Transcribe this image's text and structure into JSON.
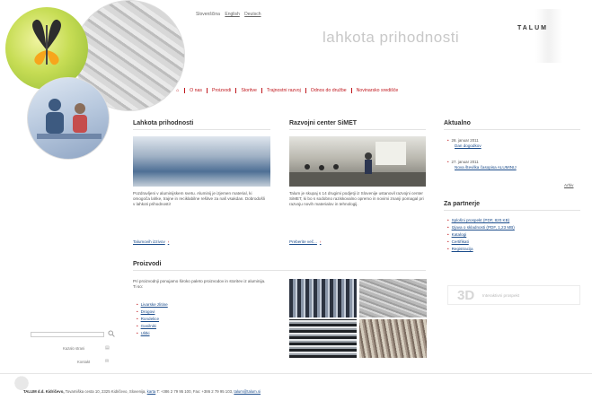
{
  "header": {
    "top_links": [
      "Slovenščina",
      "English",
      "Deutsch"
    ],
    "tagline": "lahkota prihodnosti",
    "logo": "TALUM"
  },
  "nav": {
    "home_label": "⌂",
    "items": [
      "O nas",
      "Proizvodi",
      "Storitve",
      "Trajnostni razvoj",
      "Odnos do družbe",
      "Novinarsko središče"
    ]
  },
  "col1": {
    "title": "Lahkota prihodnosti",
    "text": "Pozdravljeni v aluminijskem svetu. Aluminij je izjemen material, ki omogoča lahke, trajne in reciklabilne rešitve za naš vsakdan. Dobrodošli v lahkoti prihodnosti!",
    "link": "Talumovih izzivov"
  },
  "col2": {
    "title": "Razvojni center SiMET",
    "text": "Talum je skupaj s 14 drugimi podjetji iz Slovenije ustanovil razvojni center SiMET, ki bo s sodobno raziskovalno opremo in novimi znanji pomagal pri razvoju novih materialov in tehnologij.",
    "link": "Preberite več..."
  },
  "products": {
    "title": "Proizvodi",
    "text": "Pri proizvodnji ponujamo široko paleto proizvodov in storitev iz aluminija. Ti so:",
    "items": [
      "Livarske zlitine",
      "Drogovi",
      "Rondelice",
      "Gasilniki",
      "Ulitki"
    ]
  },
  "news": {
    "title": "Aktualno",
    "entries": [
      {
        "date": "28. januar 2011",
        "link": "Dan dogodkov"
      },
      {
        "date": "27. januar 2011",
        "link": "Nova številka časopisa ALUMINIJ"
      }
    ],
    "more": "Arhiv"
  },
  "partners": {
    "title": "Za partnerje",
    "items": [
      "Splošni prospekt (PDF, 820 KB)",
      "Izjava o skladnosti (PDF, 1,23 MB)",
      "Katalogi",
      "Certifikati",
      "Registracija"
    ]
  },
  "panel3d": {
    "big": "3D",
    "small": "Interaktivni prospekt"
  },
  "sidebar": {
    "search_placeholder": "",
    "link1": "Kazalo strani",
    "link2": "Kontakt"
  },
  "footer": {
    "company": "TALUM d.d. Kidričevo,",
    "address": "Tovarniška cesta 10, 2325 Kidričevo, Slovenija,",
    "contact_link": "karta",
    "phone": "T: +386 2 79 95 100, Fax: +386 2 79 95 103,",
    "email": "talum@talum.si"
  }
}
